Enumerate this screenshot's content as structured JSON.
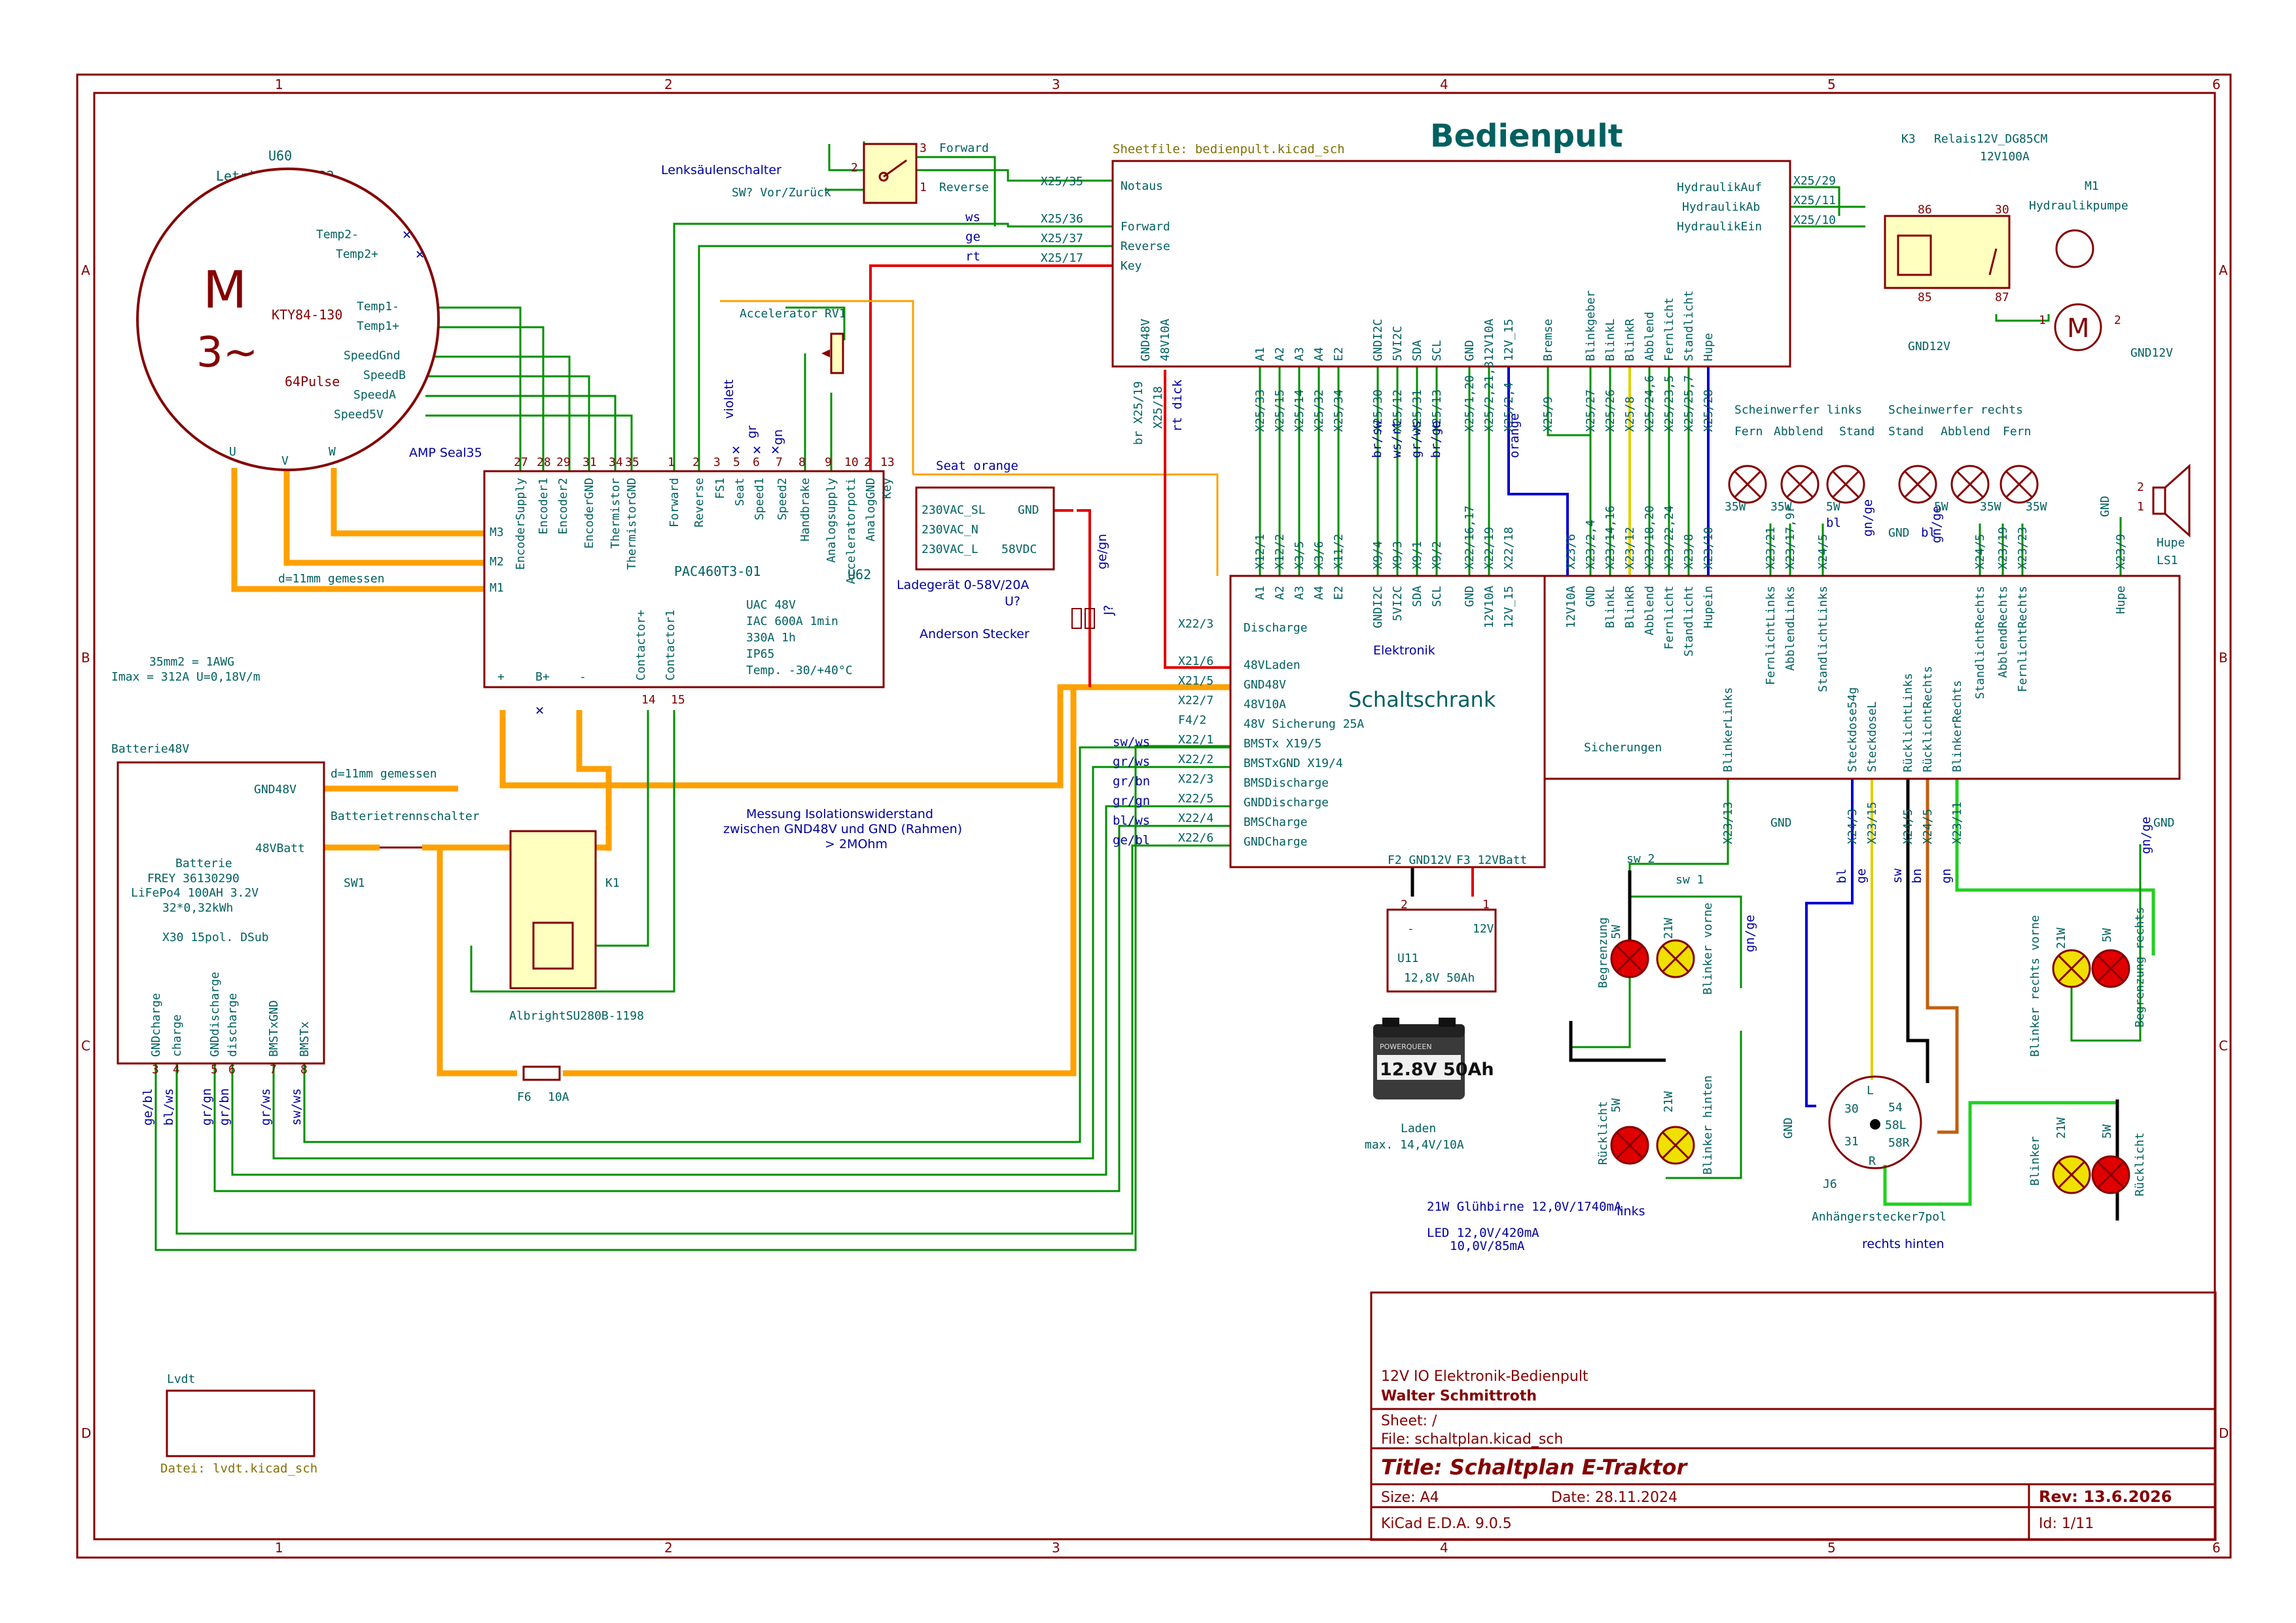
{
  "sheet": {
    "grid_cols": [
      "1",
      "2",
      "3",
      "4",
      "5",
      "6"
    ],
    "grid_rows": [
      "A",
      "B",
      "C",
      "D"
    ]
  },
  "title_block": {
    "comment": "12V IO Elektronik-Bedienpult",
    "author": "Walter Schmittroth",
    "sheet": "Sheet: /",
    "file": "File: schaltplan.kicad_sch",
    "title": "Title: Schaltplan E-Traktor",
    "size": "Size: A4",
    "date": "Date: 28.11.2024",
    "rev": "Rev: 13.6.2026",
    "tool": "KiCad E.D.A. 9.0.5",
    "id": "Id: 1/11"
  },
  "motor": {
    "ref": "U60",
    "value": "Letrika AMV7122",
    "symbol_top": "M",
    "symbol_bottom": "3~",
    "kty": "KTY84-130",
    "pulse": "64Pulse",
    "pins": [
      "Temp2-",
      "Temp2+",
      "Temp1-",
      "Temp1+",
      "SpeedGnd",
      "SpeedB",
      "SpeedA",
      "Speed5V"
    ],
    "phase_pins": [
      "U",
      "V",
      "W"
    ],
    "connector": "AMP Seal35"
  },
  "controller": {
    "ref": "U62",
    "value": "PAC460T3-01",
    "top_pins": [
      "EncoderSupply",
      "Encoder1",
      "Encoder2",
      "EncoderGND",
      "Thermistor",
      "ThermistorGND",
      "Forward",
      "Reverse",
      "FS1",
      "Seat",
      "Speed1",
      "Speed2",
      "Handbrake",
      "Analogsupply",
      "Acceleratorpoti",
      "AnalogGND",
      "Key"
    ],
    "top_pin_nums": [
      "27",
      "28",
      "29",
      "31",
      "34",
      "35",
      "1",
      "2",
      "3",
      "5",
      "6",
      "7",
      "8",
      "9",
      "10",
      "2",
      "13"
    ],
    "phase": [
      "M3",
      "M2",
      "M1"
    ],
    "bottom_pins": [
      "+",
      "B+",
      "-",
      "Contactor+",
      "Contactor1"
    ],
    "bottom_pin_nums": [
      "14",
      "15"
    ],
    "specs": [
      "UAC    48V",
      "IAC    600A 1min",
      "       330A 1h",
      "IP65",
      "Temp. -30/+40°C"
    ],
    "wire_notes": [
      "violett",
      "gr",
      "gn"
    ]
  },
  "lenksaeule": {
    "title": "Lenksäulenschalter",
    "ref": "SW? Vor/Zurück",
    "forward": "Forward",
    "reverse": "Reverse",
    "pins": [
      "3",
      "2",
      "1"
    ]
  },
  "accelerator": {
    "title": "Accelerator RV1"
  },
  "charger": {
    "rows": [
      "230VAC_SL",
      "230VAC_N",
      "230VAC_L"
    ],
    "gnd": "GND",
    "vdc": "58VDC",
    "label": "Ladegerät 0-58V/20A",
    "ref": "U?",
    "anderson": "Anderson Stecker",
    "j": "J?",
    "wire": "ge/gn"
  },
  "wire_labels": {
    "ws": "ws",
    "ge": "ge",
    "rt": "rt",
    "seat": "Seat orange",
    "x25_35": "X25/35",
    "x25_36": "X25/36",
    "x25_37": "X25/37",
    "x25_17": "X25/17",
    "x25_19": "br X25/19",
    "x25_18": "X25/18",
    "rt_dick": "rt dick",
    "d11_1": "d=11mm gemessen",
    "d11_2": "d=11mm gemessen",
    "awg": "35mm2 = 1AWG",
    "imax": "Imax = 312A U=0,18V/m",
    "mess1": "Messung Isolationswiderstand",
    "mess2": "zwischen GND48V und GND (Rahmen)",
    "mess3": "> 2MOhm"
  },
  "bedienpult": {
    "title": "Bedienpult",
    "sheetfile": "Sheetfile: bedienpult.kicad_sch",
    "left_pins": [
      "Notaus",
      "Forward",
      "Reverse",
      "Key"
    ],
    "right_pins": [
      "HydraulikAuf",
      "HydraulikAb",
      "HydraulikEin"
    ],
    "right_nets": [
      "X25/29",
      "X25/11",
      "X25/10"
    ],
    "bottom_pins": [
      "GND48V",
      "48V10A",
      "A1",
      "A2",
      "A3",
      "A4",
      "E2",
      "GNDI2C",
      "5VI2C",
      "SDA",
      "SCL",
      "GND",
      "12V10A",
      "12V_15",
      "Bremse",
      "Blinkgeber",
      "BlinkL",
      "BlinkR",
      "Abblend",
      "Fernlicht",
      "Standlicht",
      "Hupe"
    ],
    "bottom_nets": [
      "X25/33",
      "X25/15",
      "X25/14",
      "X25/32",
      "X25/34",
      "X25/30",
      "X25/12",
      "X25/31",
      "X25/13",
      "X25/1,20",
      "X25/2,21,3",
      "X25/2,4",
      "X25/9",
      "X25/27",
      "X25/26",
      "X25/8",
      "X25/24,6",
      "X25/23,5",
      "X25/25,7",
      "X25/28"
    ],
    "bottom_net_notes": [
      "br/sw",
      "ws/rt",
      "gr/ws",
      "br/ge",
      "orange"
    ]
  },
  "schaltschrank": {
    "title": "Schaltschrank",
    "left_pins": [
      "Discharge",
      "48VLaden",
      "GND48V",
      "48V10A",
      "48V Sicherung 25A",
      "BMSTx X19/5",
      "BMSTxGND X19/4",
      "BMSDischarge",
      "GNDDischarge",
      "BMSCharge",
      "GNDCharge"
    ],
    "left_nets": [
      "X22/3",
      "X21/6",
      "X21/5",
      "X22/7",
      "F4/2",
      "X22/1",
      "X22/2",
      "X22/3",
      "X22/5",
      "X22/4",
      "X22/6"
    ],
    "left_wires": [
      "sw/ws",
      "gr/ws",
      "gr/bn",
      "gr/gn",
      "bl/ws",
      "ge/bl"
    ],
    "top_pins": [
      "A1",
      "A2",
      "A3",
      "A4",
      "E2",
      "GNDI2C",
      "5VI2C",
      "SDA",
      "SCL",
      "GND",
      "12V10A",
      "12V_15"
    ],
    "top_nets": [
      "X12/1",
      "X12/2",
      "X3/5",
      "X3/6",
      "X11/2",
      "X9/4",
      "X9/3",
      "X9/1",
      "X9/2",
      "X22/16,17",
      "X22/19",
      "X22/18"
    ],
    "elektronik": "Elektronik",
    "f2": "F2 GND12V",
    "f3": "F3 12VBatt"
  },
  "sicherungen": {
    "title": "Sicherungen",
    "top_pins": [
      "12V10A",
      "GND",
      "BlinkL",
      "BlinkR",
      "Abblend",
      "Fernlicht",
      "Standlicht",
      "Hupein",
      "FernlichtLinks",
      "AbblendLinks",
      "StandlichtLinks",
      "StandlichtRechts",
      "AbblendRechts",
      "FernlichtRechts",
      "Hupe"
    ],
    "top_nets": [
      "X23/6",
      "X23/2,4",
      "X23/14,16",
      "X23/12",
      "X23/18,20",
      "X23/22,24",
      "X23/8",
      "X23/10",
      "X23/21",
      "X23/17,9r",
      "X24/5",
      "X24/5",
      "X23/19",
      "X23/23",
      "X23/9"
    ],
    "bottom_pins": [
      "BlinkerLinks",
      "Steckdose54g",
      "SteckdoseL",
      "RücklichtLinks",
      "RücklichtRechts",
      "BlinkerRechts"
    ],
    "bottom_nets": [
      "X23/13",
      "X24/3",
      "X23/15",
      "X24/5",
      "X24/5",
      "X23/11"
    ],
    "bottom_wires": [
      "bl",
      "ge",
      "sw",
      "bn",
      "gn"
    ]
  },
  "relay": {
    "ref": "K3",
    "value": "Relais12V_DG85CM",
    "current": "12V100A",
    "pins": [
      "86",
      "30",
      "85",
      "87"
    ],
    "gnd": "GND12V"
  },
  "pump": {
    "ref": "M1",
    "value": "Hydraulikpumpe",
    "pins": [
      "1",
      "2"
    ],
    "gnd": "GND12V"
  },
  "headlights": {
    "left": "Scheinwerfer links",
    "right": "Scheinwerfer rechts",
    "cols": [
      "Fern",
      "Abblend",
      "Stand",
      "Stand",
      "Abblend",
      "Fern"
    ],
    "watts": [
      "35W",
      "35W",
      "5W",
      "5W",
      "35W",
      "35W"
    ],
    "wires": [
      "bl",
      "gn/ge",
      "bl",
      "gn/ge"
    ],
    "gnd": "GND"
  },
  "horn": {
    "ref": "LS1",
    "value": "Hupe",
    "gnd": "GND",
    "pins": [
      "2",
      "1"
    ]
  },
  "battery48": {
    "frame": "Batterie48V",
    "gnd": "GND48V",
    "batt": "48VBatt",
    "name": "Batterie",
    "model": "FREY 36130290",
    "cell": "LiFePo4 100AH 3.2V",
    "energy": "32*0,32kWh",
    "connector": "X30 15pol. DSub",
    "pins": [
      "GNDcharge",
      "charge",
      "GNDdischarge",
      "discharge",
      "BMSTxGND",
      "BMSTx"
    ],
    "pin_nums": [
      "3",
      "4",
      "5",
      "6",
      "7",
      "8"
    ],
    "wires": [
      "ge/bl",
      "bl/ws",
      "gr/gn",
      "gr/bn",
      "gr/ws",
      "sw/ws"
    ]
  },
  "contactor": {
    "ref": "K1",
    "value": "AlbrightSU280B-1198",
    "sw_label": "Batterietrennschalter",
    "sw_ref": "SW1"
  },
  "fuse": {
    "ref": "F6",
    "value": "10A"
  },
  "battery12": {
    "ref": "U11",
    "value": "12,8V 50Ah",
    "pins": [
      "-",
      "12V"
    ],
    "nums": [
      "2",
      "1"
    ],
    "img_text": "12.8V 50Ah",
    "img_brand": "POWERQUEEN",
    "charge": "Laden",
    "charge_max": "max. 14,4V/10A"
  },
  "rear": {
    "sw2": "sw 2",
    "sw1": "sw 1",
    "bulb_left_top": [
      "Begrenzung",
      "5W",
      "21W",
      "Blinker vorne"
    ],
    "bulb_left_bottom": [
      "Rücklicht",
      "5W",
      "21W",
      "Blinker hinten"
    ],
    "bulb_right_top": [
      "Blinker rechts vorne",
      "21W",
      "5W",
      "Begrenzung rechts"
    ],
    "bulb_right_bottom": [
      "Blinker",
      "21W",
      "5W",
      "Rücklicht"
    ],
    "gnd": "GND",
    "wires": [
      "gn/ge",
      "gn/ge",
      "gn/ge"
    ],
    "notes": [
      "21W Glühbirne 12,0V/1740mA",
      "LED 12,0V/420mA",
      "10,0V/85mA"
    ],
    "links": "links",
    "rechts_hinten": "rechts hinten"
  },
  "trailer": {
    "ref": "J6",
    "value": "Anhängerstecker7pol",
    "pins": [
      "L",
      "54",
      "58L",
      "58R",
      "R",
      "31",
      "30"
    ],
    "nums": [
      "1",
      "2",
      "3",
      "4",
      "5",
      "6",
      "7"
    ]
  },
  "lvdt": {
    "name": "Lvdt",
    "file": "Datei: lvdt.kicad_sch"
  }
}
